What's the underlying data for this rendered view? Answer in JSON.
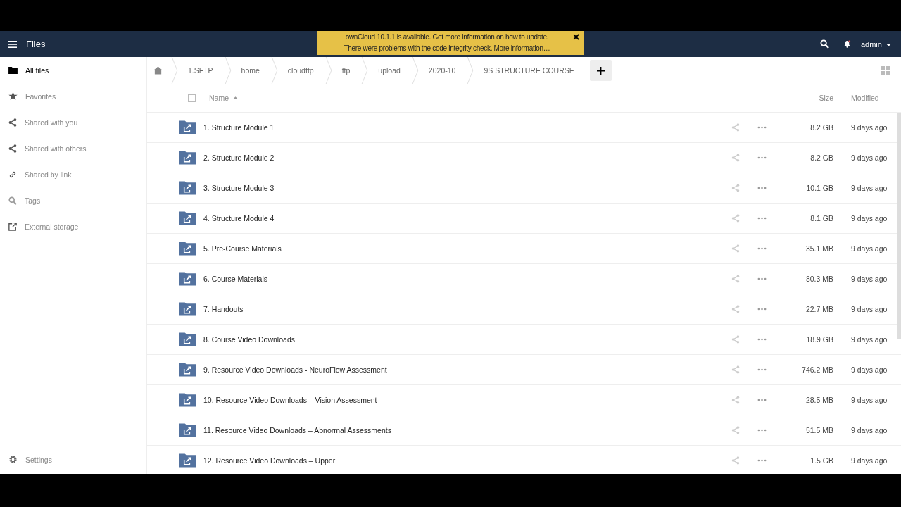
{
  "header": {
    "app_title": "Files",
    "user": "admin"
  },
  "notification": {
    "lines": [
      "ownCloud 10.1.1 is available. Get more information on how to update.",
      "There were problems with the code integrity check. More information…"
    ]
  },
  "sidebar": {
    "items": [
      {
        "label": "All files",
        "kind": "folder",
        "selected": true
      },
      {
        "label": "Favorites",
        "kind": "star",
        "selected": false
      },
      {
        "label": "Shared with you",
        "kind": "share",
        "selected": false
      },
      {
        "label": "Shared with others",
        "kind": "share",
        "selected": false
      },
      {
        "label": "Shared by link",
        "kind": "link",
        "selected": false
      },
      {
        "label": "Tags",
        "kind": "search",
        "selected": false
      },
      {
        "label": "External storage",
        "kind": "external",
        "selected": false
      }
    ],
    "settings": "Settings"
  },
  "breadcrumb": [
    "1.SFTP",
    "home",
    "cloudftp",
    "ftp",
    "upload",
    "2020-10",
    "9S STRUCTURE COURSE"
  ],
  "table": {
    "select_all_checked": false,
    "columns": [
      "Name",
      "Size",
      "Modified"
    ],
    "rows": [
      {
        "name": "1. Structure Module 1",
        "size": "8.2 GB",
        "modified": "9 days ago"
      },
      {
        "name": "2. Structure Module 2",
        "size": "8.2 GB",
        "modified": "9 days ago"
      },
      {
        "name": "3. Structure Module 3",
        "size": "10.1 GB",
        "modified": "9 days ago"
      },
      {
        "name": "4. Structure Module 4",
        "size": "8.1 GB",
        "modified": "9 days ago"
      },
      {
        "name": "5. Pre-Course Materials",
        "size": "35.1 MB",
        "modified": "9 days ago"
      },
      {
        "name": "6. Course Materials",
        "size": "80.3 MB",
        "modified": "9 days ago"
      },
      {
        "name": "7. Handouts",
        "size": "22.7 MB",
        "modified": "9 days ago"
      },
      {
        "name": "8. Course Video Downloads",
        "size": "18.9 GB",
        "modified": "9 days ago"
      },
      {
        "name": "9. Resource Video Downloads - NeuroFlow Assessment",
        "size": "746.2 MB",
        "modified": "9 days ago"
      },
      {
        "name": "10. Resource Video Downloads – Vision Assessment",
        "size": "28.5 MB",
        "modified": "9 days ago"
      },
      {
        "name": "11. Resource Video Downloads – Abnormal Assessments",
        "size": "51.5 MB",
        "modified": "9 days ago"
      },
      {
        "name": "12. Resource Video Downloads – Upper",
        "size": "1.5 GB",
        "modified": "9 days ago"
      }
    ]
  }
}
